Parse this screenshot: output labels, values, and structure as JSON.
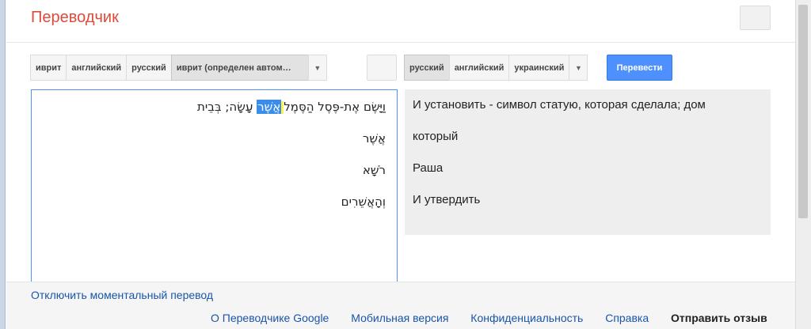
{
  "app": {
    "title": "Переводчик"
  },
  "source_langs": {
    "tabs": [
      "иврит",
      "английский",
      "русский",
      "иврит (определен автом…"
    ],
    "active_index": 3
  },
  "target_langs": {
    "tabs": [
      "русский",
      "английский",
      "украинский"
    ],
    "active_index": 0
  },
  "translate_button": "Перевести",
  "source_text": {
    "line1_pre": "וַיָּשֶׂם אֶת-פֶּסֶל הַסֶּמֶל",
    "line1_highlight": "אֲשֶׁר",
    "line1_post": "עָשָׂה; בְּבֵית",
    "line2": "אֲשֶׁר",
    "line3": "רֹשָׁא",
    "line4": "וְהָאֲשֵׁרִים"
  },
  "result_text": {
    "line1": "И установить - символ статую, которая сделала; дом",
    "line2": "который",
    "line3": "Раша",
    "line4": "И утвердить"
  },
  "footer": {
    "instant_toggle": "Отключить моментальный перевод",
    "links": [
      "О Переводчике Google",
      "Мобильная версия",
      "Конфиденциальность",
      "Справка"
    ],
    "feedback": "Отправить отзыв"
  },
  "colors": {
    "title": "#dd4b39",
    "primary_button": "#4d90fe",
    "link": "#1a55a8",
    "selection": "#3b8dea",
    "cursor_highlight": "#fff34f"
  }
}
